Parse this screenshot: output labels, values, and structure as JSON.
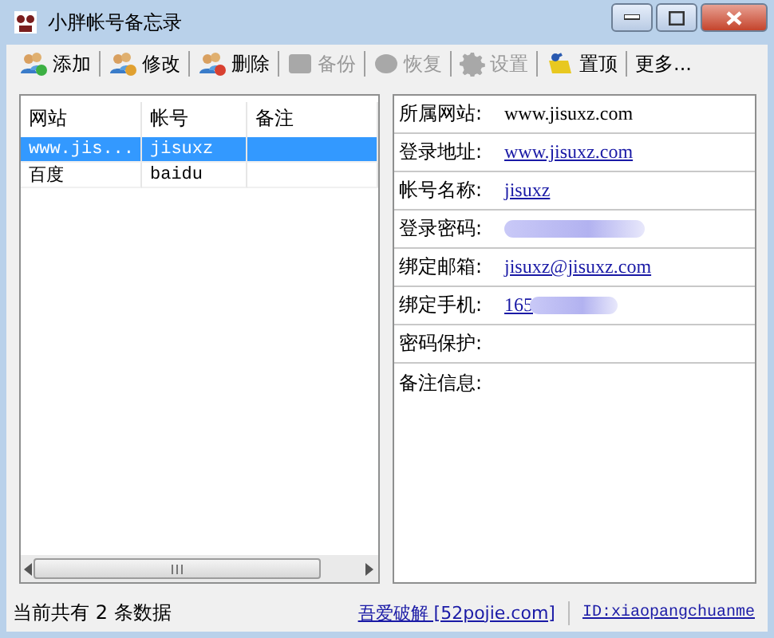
{
  "window": {
    "title": "小胖帐号备忘录"
  },
  "toolbar": [
    {
      "label": "添加",
      "disabled": false
    },
    {
      "label": "修改",
      "disabled": false
    },
    {
      "label": "删除",
      "disabled": false
    },
    {
      "label": "备份",
      "disabled": true
    },
    {
      "label": "恢复",
      "disabled": true
    },
    {
      "label": "设置",
      "disabled": true
    },
    {
      "label": "置顶",
      "disabled": false
    },
    {
      "label": "更多...",
      "disabled": false
    }
  ],
  "table": {
    "columns": [
      "网站",
      "帐号",
      "备注"
    ],
    "rows": [
      {
        "cells": [
          "www.jis...",
          "jisuxz"
        ],
        "selected": true
      },
      {
        "cells": [
          "百度",
          "baidu"
        ],
        "selected": false
      }
    ]
  },
  "details": [
    {
      "label": "所属网站:",
      "value": "www.jisuxz.com",
      "kind": "text"
    },
    {
      "label": "登录地址:",
      "value": "www.jisuxz.com",
      "kind": "link"
    },
    {
      "label": "帐号名称:",
      "value": "jisuxz",
      "kind": "link"
    },
    {
      "label": "登录密码:",
      "kind": "hidden"
    },
    {
      "label": "绑定邮箱:",
      "value": "jisuxz@jisuxz.com",
      "kind": "link"
    },
    {
      "label": "绑定手机:",
      "value": "165",
      "kind": "partly_hidden"
    },
    {
      "label": "密码保护:",
      "kind": "empty"
    },
    {
      "label": "备注信息:",
      "kind": "empty"
    }
  ],
  "status_bar": {
    "count": "当前共有 2 条数据",
    "link": "吾爱破解 [52pojie.com]",
    "id": "ID:xiaopangchuanme"
  }
}
